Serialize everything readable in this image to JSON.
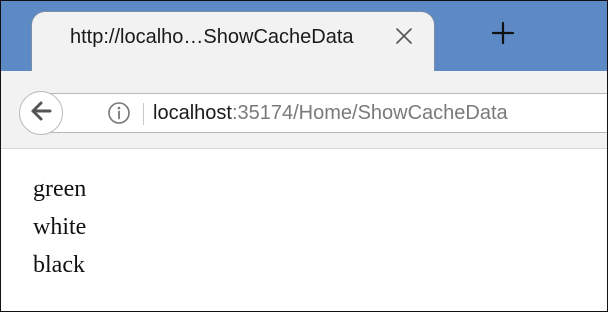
{
  "browser": {
    "tab": {
      "title": "http://localho…ShowCacheData"
    },
    "address_bar": {
      "host": "localhost",
      "path": ":35174/Home/ShowCacheData"
    }
  },
  "page": {
    "items": [
      "green",
      "white",
      "black"
    ]
  },
  "icons": {
    "close": "close-icon",
    "new_tab": "plus-icon",
    "back": "back-arrow-icon",
    "info": "info-icon"
  },
  "colors": {
    "title_bar": "#5d89c4",
    "tab_background": "#f2f2f2",
    "url_path": "#7a7a7a",
    "text": "#111111"
  }
}
